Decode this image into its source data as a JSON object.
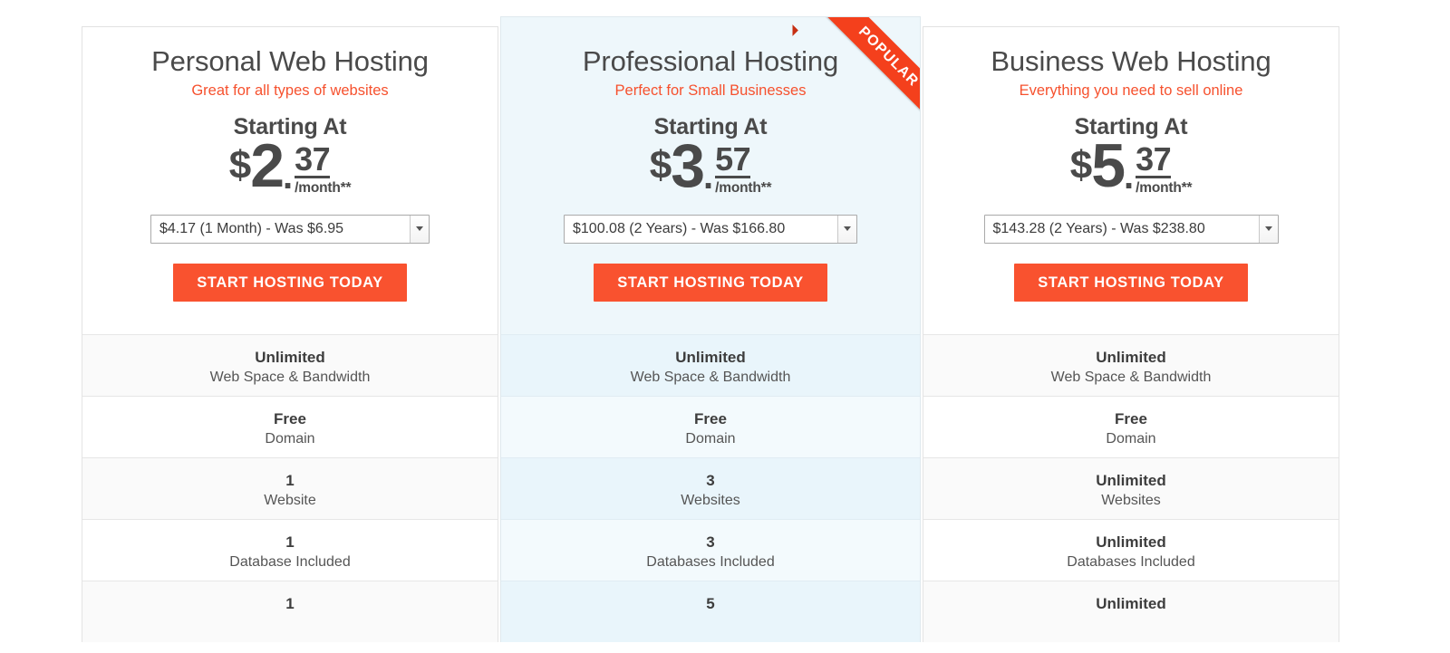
{
  "plans": [
    {
      "id": "personal",
      "title": "Personal Web Hosting",
      "subtitle": "Great for all types of websites",
      "starting_at": "Starting At",
      "currency": "$",
      "dollars": "2",
      "dot": ".",
      "cents": "37",
      "period": "/month**",
      "term_option": "$4.17 (1 Month) - Was $6.95",
      "cta": "START HOSTING TODAY",
      "featured": false,
      "features": [
        {
          "value": "Unlimited",
          "label": "Web Space & Bandwidth"
        },
        {
          "value": "Free",
          "label": "Domain"
        },
        {
          "value": "1",
          "label": "Website"
        },
        {
          "value": "1",
          "label": "Database Included"
        },
        {
          "value": "1",
          "label": ""
        }
      ]
    },
    {
      "id": "professional",
      "title": "Professional Hosting",
      "subtitle": "Perfect for Small Businesses",
      "starting_at": "Starting At",
      "currency": "$",
      "dollars": "3",
      "dot": ".",
      "cents": "57",
      "period": "/month**",
      "term_option": "$100.08 (2 Years) - Was $166.80",
      "cta": "START HOSTING TODAY",
      "featured": true,
      "ribbon": "POPULAR",
      "features": [
        {
          "value": "Unlimited",
          "label": "Web Space & Bandwidth"
        },
        {
          "value": "Free",
          "label": "Domain"
        },
        {
          "value": "3",
          "label": "Websites"
        },
        {
          "value": "3",
          "label": "Databases Included"
        },
        {
          "value": "5",
          "label": ""
        }
      ]
    },
    {
      "id": "business",
      "title": "Business Web Hosting",
      "subtitle": "Everything you need to sell online",
      "starting_at": "Starting At",
      "currency": "$",
      "dollars": "5",
      "dot": ".",
      "cents": "37",
      "period": "/month**",
      "term_option": "$143.28 (2 Years) - Was $238.80",
      "cta": "START HOSTING TODAY",
      "featured": false,
      "features": [
        {
          "value": "Unlimited",
          "label": "Web Space & Bandwidth"
        },
        {
          "value": "Free",
          "label": "Domain"
        },
        {
          "value": "Unlimited",
          "label": "Websites"
        },
        {
          "value": "Unlimited",
          "label": "Databases Included"
        },
        {
          "value": "Unlimited",
          "label": ""
        }
      ]
    }
  ],
  "colors": {
    "accent_orange": "#f6512e",
    "cta_orange": "#f9522f",
    "ribbon_red": "#f4401c",
    "featured_bg": "#eef7fb",
    "text_dark": "#4a4a4a"
  },
  "icons": {
    "dropdown": "chevron-down-icon"
  }
}
